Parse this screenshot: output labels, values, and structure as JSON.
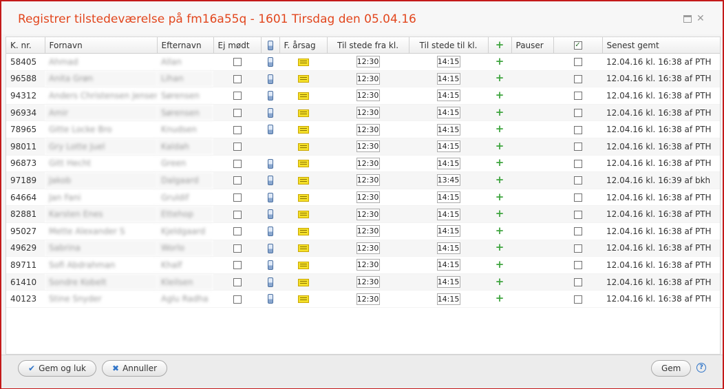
{
  "dialog": {
    "title": "Registrer tilstedeværelse på fm16a55q - 1601 Tirsdag den 05.04.16"
  },
  "columns": {
    "knr": "K. nr.",
    "fornavn": "Fornavn",
    "efternavn": "Efternavn",
    "ejmoedt": "Ej mødt",
    "aarsag": "F. årsag",
    "fra": "Til stede fra kl.",
    "til": "Til stede til kl.",
    "pauser": "Pauser",
    "senest": "Senest gemt"
  },
  "icons": {
    "phone": "phone-icon",
    "note": "note-icon",
    "plus": "plus-icon",
    "check": "checkbox-icon"
  },
  "rows": [
    {
      "knr": "58405",
      "fornavn": "Ahmad",
      "efternavn": "Allan",
      "phone": true,
      "fra": "12:30",
      "til": "14:15",
      "senest": "12.04.16 kl. 16:38 af PTH"
    },
    {
      "knr": "96588",
      "fornavn": "Anita Grøn",
      "efternavn": "Lihan",
      "phone": true,
      "fra": "12:30",
      "til": "14:15",
      "senest": "12.04.16 kl. 16:38 af PTH"
    },
    {
      "knr": "94312",
      "fornavn": "Anders Christensen Jensen",
      "efternavn": "Sørensen",
      "phone": true,
      "fra": "12:30",
      "til": "14:15",
      "senest": "12.04.16 kl. 16:38 af PTH"
    },
    {
      "knr": "96934",
      "fornavn": "Amir",
      "efternavn": "Sørensen",
      "phone": true,
      "fra": "12:30",
      "til": "14:15",
      "senest": "12.04.16 kl. 16:38 af PTH"
    },
    {
      "knr": "78965",
      "fornavn": "Gitte Locke Bro",
      "efternavn": "Knudsen",
      "phone": true,
      "fra": "12:30",
      "til": "14:15",
      "senest": "12.04.16 kl. 16:38 af PTH"
    },
    {
      "knr": "98011",
      "fornavn": "Gry Lotte Juel",
      "efternavn": "Kaldah",
      "phone": false,
      "fra": "12:30",
      "til": "14:15",
      "senest": "12.04.16 kl. 16:38 af PTH"
    },
    {
      "knr": "96873",
      "fornavn": "Gitt Hecht",
      "efternavn": "Green",
      "phone": true,
      "fra": "12:30",
      "til": "14:15",
      "senest": "12.04.16 kl. 16:38 af PTH"
    },
    {
      "knr": "97189",
      "fornavn": "Jakob",
      "efternavn": "Dalgaard",
      "phone": true,
      "fra": "12:30",
      "til": "13:45",
      "senest": "12.04.16 kl. 16:39 af bkh"
    },
    {
      "knr": "64664",
      "fornavn": "Jan Fani",
      "efternavn": "Gruldif",
      "phone": true,
      "fra": "12:30",
      "til": "14:15",
      "senest": "12.04.16 kl. 16:38 af PTH"
    },
    {
      "knr": "82881",
      "fornavn": "Karsten Enes",
      "efternavn": "Ettehop",
      "phone": true,
      "fra": "12:30",
      "til": "14:15",
      "senest": "12.04.16 kl. 16:38 af PTH"
    },
    {
      "knr": "95027",
      "fornavn": "Mette Alexander S",
      "efternavn": "Kjeldgaard",
      "phone": true,
      "fra": "12:30",
      "til": "14:15",
      "senest": "12.04.16 kl. 16:38 af PTH"
    },
    {
      "knr": "49629",
      "fornavn": "Sabrina",
      "efternavn": "Worlo",
      "phone": true,
      "fra": "12:30",
      "til": "14:15",
      "senest": "12.04.16 kl. 16:38 af PTH"
    },
    {
      "knr": "89711",
      "fornavn": "Sofi Abdrahman",
      "efternavn": "Khalf",
      "phone": true,
      "fra": "12:30",
      "til": "14:15",
      "senest": "12.04.16 kl. 16:38 af PTH"
    },
    {
      "knr": "61410",
      "fornavn": "Sondre Kobelt",
      "efternavn": "Kleilsen",
      "phone": true,
      "fra": "12:30",
      "til": "14:15",
      "senest": "12.04.16 kl. 16:38 af PTH"
    },
    {
      "knr": "40123",
      "fornavn": "Stine Snyder",
      "efternavn": "Aglu Radha",
      "phone": true,
      "fra": "12:30",
      "til": "14:15",
      "senest": "12.04.16 kl. 16:38 af PTH"
    }
  ],
  "footer": {
    "save_close": "Gem og luk",
    "cancel": "Annuller",
    "save": "Gem",
    "help": "?"
  },
  "colors": {
    "title": "#e2461d",
    "border": "#c41a1a",
    "plus": "#3ea43e",
    "accent": "#2f74c8"
  }
}
